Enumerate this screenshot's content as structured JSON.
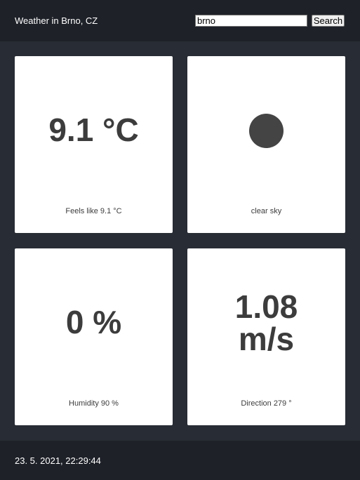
{
  "header": {
    "title": "Weather in Brno, CZ",
    "search_value": "brno",
    "search_label": "Search"
  },
  "cards": {
    "temperature": {
      "value": "9.1 °C",
      "caption": "Feels like 9.1 °C"
    },
    "sky": {
      "icon": "weather-circle-icon",
      "caption": "clear sky"
    },
    "humidity": {
      "value": "0 %",
      "caption": "Humidity 90 %"
    },
    "wind": {
      "value_line1": "1.08",
      "value_line2": "m/s",
      "caption": "Direction 279 °"
    }
  },
  "footer": {
    "timestamp": "23. 5. 2021, 22:29:44"
  },
  "colors": {
    "background": "#282c34",
    "bar": "#1e2128",
    "card": "#ffffff",
    "text_dark": "#3c3c3c",
    "icon": "#444444"
  }
}
